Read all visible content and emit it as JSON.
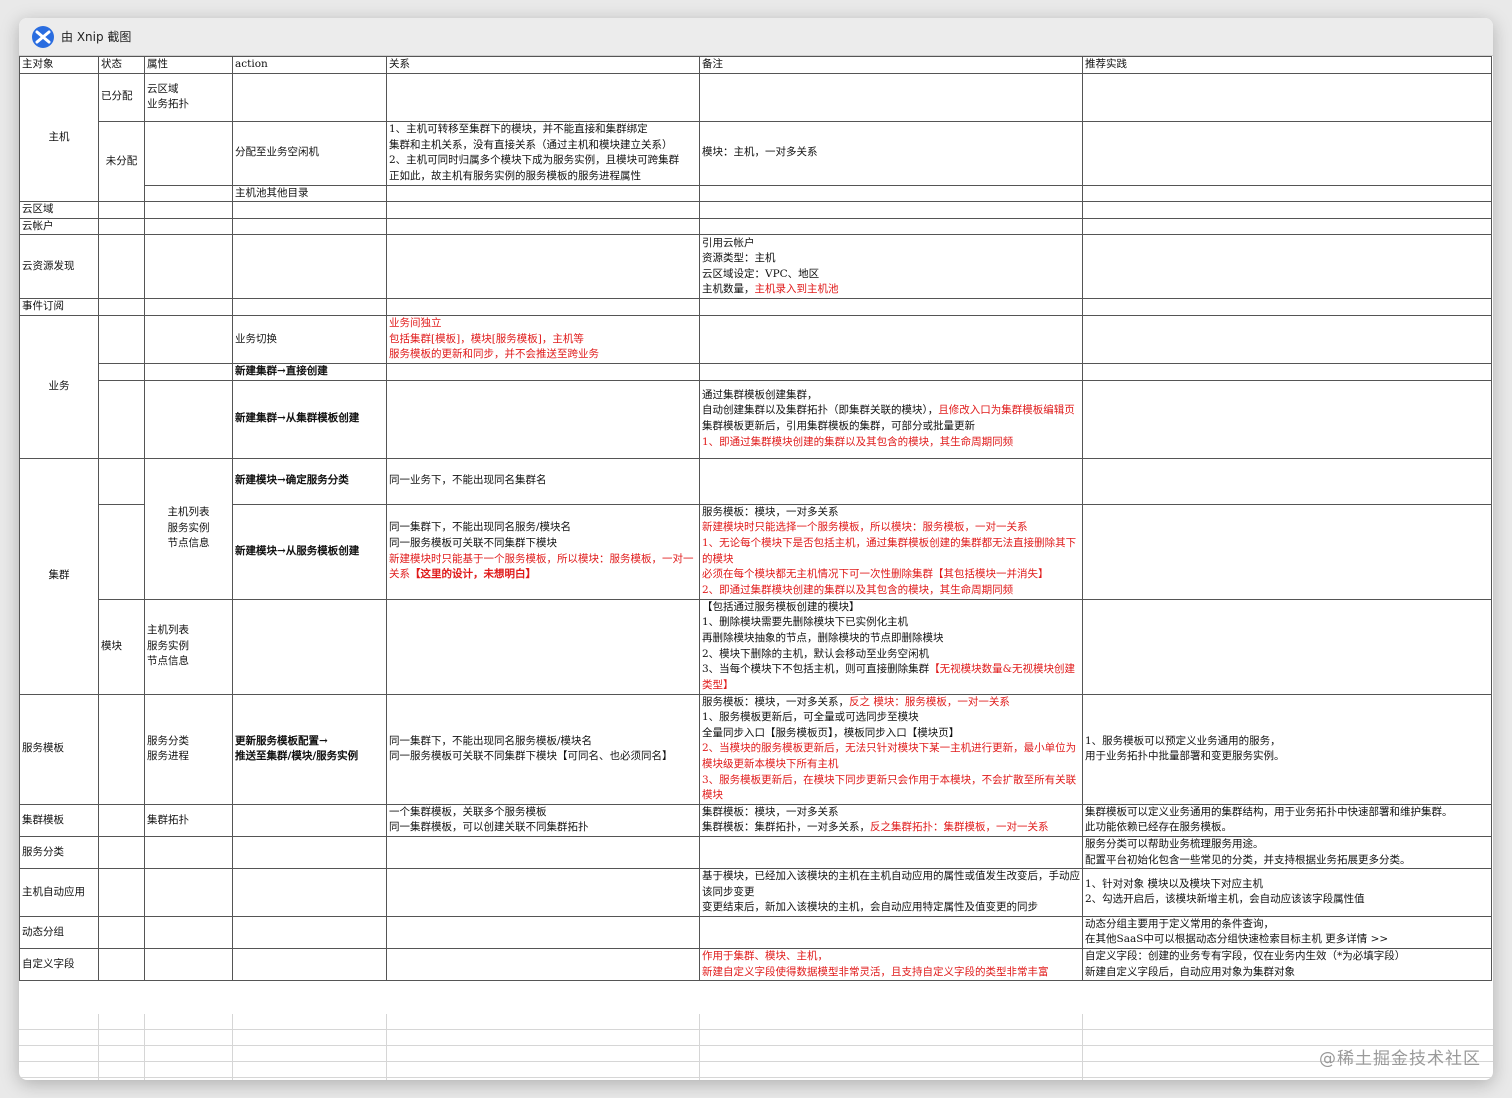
{
  "window": {
    "title": "由 Xnip 截图"
  },
  "headers": [
    "主对象",
    "状态",
    "属性",
    "action",
    "关系",
    "备注",
    "推荐实践"
  ],
  "rows": {
    "host": {
      "object": "主机",
      "assigned": {
        "status": "已分配",
        "attr": [
          "云区域",
          "业务拓扑"
        ]
      },
      "unassigned": {
        "status": "未分配",
        "action1": "分配至业务空闲机",
        "relation1": [
          "1、主机可转移至集群下的模块，并不能直接和集群绑定",
          "集群和主机关系，没有直接关系（通过主机和模块建立关系）",
          "2、主机可同时归属多个模块下成为服务实例，且模块可跨集群",
          "正如此，故主机有服务实例的服务模板的服务进程属性"
        ],
        "note1": "模块：主机，一对多关系",
        "action2": "主机池其他目录"
      }
    },
    "cloud_area": {
      "object": "云区域"
    },
    "cloud_account": {
      "object": "云帐户"
    },
    "cloud_discovery": {
      "object": "云资源发现",
      "note": [
        "引用云帐户",
        "资源类型：主机",
        "云区域设定：VPC、地区"
      ],
      "note_last_a": "主机数量，",
      "note_last_b": "主机录入到主机池"
    },
    "event_sub": {
      "object": "事件订阅"
    },
    "business": {
      "object": "业务",
      "action1": "业务切换",
      "relation1": [
        "业务间独立",
        "包括集群[模板]，模块[服务模板]，主机等",
        "服务模板的更新和同步，并不会推送至跨业务"
      ],
      "action2": "新建集群→直接创建",
      "action3": "新建集群→从集群模板创建",
      "note3_1": "通过集群模板创建集群，",
      "note3_2a": "自动创建集群以及集群拓扑（即集群关联的模块），",
      "note3_2b": "且修改入口为集群模板编辑页",
      "note3_3": "集群模板更新后，引用集群模板的集群，可部分或批量更新",
      "note3_4": "1、即通过集群模块创建的集群以及其包含的模块，其生命周期同频"
    },
    "cluster": {
      "object": "集群",
      "attr": [
        "主机列表",
        "服务实例",
        "节点信息"
      ],
      "action1": "新建模块→确定服务分类",
      "relation1": "同一业务下，不能出现同名集群名",
      "action2": "新建模块→从服务模板创建",
      "relation2_black": [
        "同一集群下，不能出现同名服务/模块名",
        "同一服务模板可关联不同集群下模块"
      ],
      "relation2_red": "新建模块时只能基于一个服务模板，所以模块：服务模板，一对一关系",
      "relation2_bold": "【这里的设计，未想明白】",
      "note2_1": "服务模板：模块，一对多关系",
      "note2_red": [
        "新建模块时只能选择一个服务模板，所以模块：服务模板，一对一关系",
        "1、无论每个模块下是否包括主机，通过集群模板创建的集群都无法直接删除其下的模块",
        "必须在每个模块都无主机情况下可一次性删除集群【其包括模块一并消失】",
        "2、即通过集群模块创建的集群以及其包含的模块，其生命周期同频"
      ]
    },
    "module": {
      "status": "模块",
      "attr": [
        "主机列表",
        "服务实例",
        "节点信息"
      ],
      "note_black": [
        "【包括通过服务模板创建的模块】",
        "1、删除模块需要先删除模块下已实例化主机",
        "再删除模块抽象的节点，删除模块的节点即删除模块",
        "2、模块下删除的主机，默认会移动至业务空闲机"
      ],
      "note_last_a": "3、当每个模块下不包括主机，则可直接删除集群",
      "note_last_b": "【无视模块数量&无视模块创建类型】"
    },
    "service_template": {
      "object": "服务模板",
      "attr": [
        "服务分类",
        "服务进程"
      ],
      "action": [
        "更新服务模板配置→",
        "推送至集群/模块/服务实例"
      ],
      "relation": [
        "同一集群下，不能出现同名服务模板/模块名",
        "同一服务模板可关联不同集群下模块【可同名、也必须同名】"
      ],
      "note1a": "服务模板：模块，一对多关系，",
      "note1b": "反之 模块：服务模板，一对一关系",
      "note_black": [
        "1、服务模板更新后，可全量或可选同步至模块",
        "全量同步入口【服务模板页】，模板同步入口【模块页】"
      ],
      "note_red": [
        "2、当模块的服务模板更新后，无法只针对模块下某一主机进行更新，最小单位为模块级更新本模块下所有主机",
        "3、服务模板更新后，在模块下同步更新只会作用于本模块，不会扩散至所有关联模块"
      ],
      "practice": [
        "1、服务模板可以预定义业务通用的服务，",
        "用于业务拓扑中批量部署和变更服务实例。"
      ]
    },
    "cluster_template": {
      "object": "集群模板",
      "attr": "集群拓扑",
      "relation": [
        "一个集群模板，关联多个服务模板",
        "同一集群模板，可以创建关联不同集群拓扑"
      ],
      "note1": "集群模板：模块，一对多关系",
      "note2a": "集群模板：集群拓扑，一对多关系，",
      "note2b": "反之集群拓扑：集群模板，一对一关系",
      "practice": [
        "集群模板可以定义业务通用的集群结构，用于业务拓扑中快速部署和维护集群。",
        "此功能依赖已经存在服务模板。"
      ]
    },
    "service_category": {
      "object": "服务分类",
      "practice": [
        "服务分类可以帮助业务梳理服务用途。",
        "配置平台初始化包含一些常见的分类，并支持根据业务拓展更多分类。"
      ]
    },
    "host_auto_apply": {
      "object": "主机自动应用",
      "note": [
        "基于模块，已经加入该模块的主机在主机自动应用的属性或值发生改变后，手动应该同步变更",
        "变更结束后，新加入该模块的主机，会自动应用特定属性及值变更的同步"
      ],
      "practice": [
        "1、针对对象 模块以及模块下对应主机",
        "2、勾选开启后，该模块新增主机，会自动应该该字段属性值"
      ]
    },
    "dynamic_group": {
      "object": "动态分组",
      "practice": [
        "动态分组主要用于定义常用的条件查询，",
        "在其他SaaS中可以根据动态分组快速检索目标主机 更多详情 >>"
      ]
    },
    "custom_field": {
      "object": "自定义字段",
      "note_red": [
        "作用于集群、模块、主机，",
        "新建自定义字段使得数据模型非常灵活，且支持自定义字段的类型非常丰富"
      ],
      "practice": [
        "自定义字段：创建的业务专有字段，仅在业务内生效（*为必填字段）",
        "新建自定义字段后，自动应用对象为集群对象"
      ]
    }
  },
  "watermark": "@稀土掘金技术社区"
}
